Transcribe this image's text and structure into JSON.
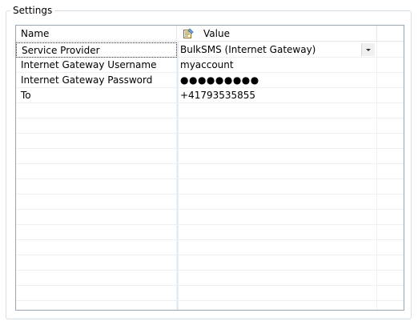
{
  "groupbox": {
    "title": "Settings"
  },
  "grid": {
    "columns": {
      "name": "Name",
      "value": "Value",
      "value_icon": "properties-icon"
    },
    "rows": [
      {
        "name": "Service Provider",
        "value": "BulkSMS (Internet Gateway)",
        "editor": "dropdown"
      },
      {
        "name": "Internet Gateway Username",
        "value": "myaccount"
      },
      {
        "name": "Internet Gateway Password",
        "value": "●●●●●●●●●"
      },
      {
        "name": "To",
        "value": "+41793535855"
      }
    ],
    "empty_row_count": 14
  },
  "colors": {
    "grid_border": "#9aa6b2",
    "group_border": "#d5dfe5",
    "row_line": "#edf0f3"
  }
}
